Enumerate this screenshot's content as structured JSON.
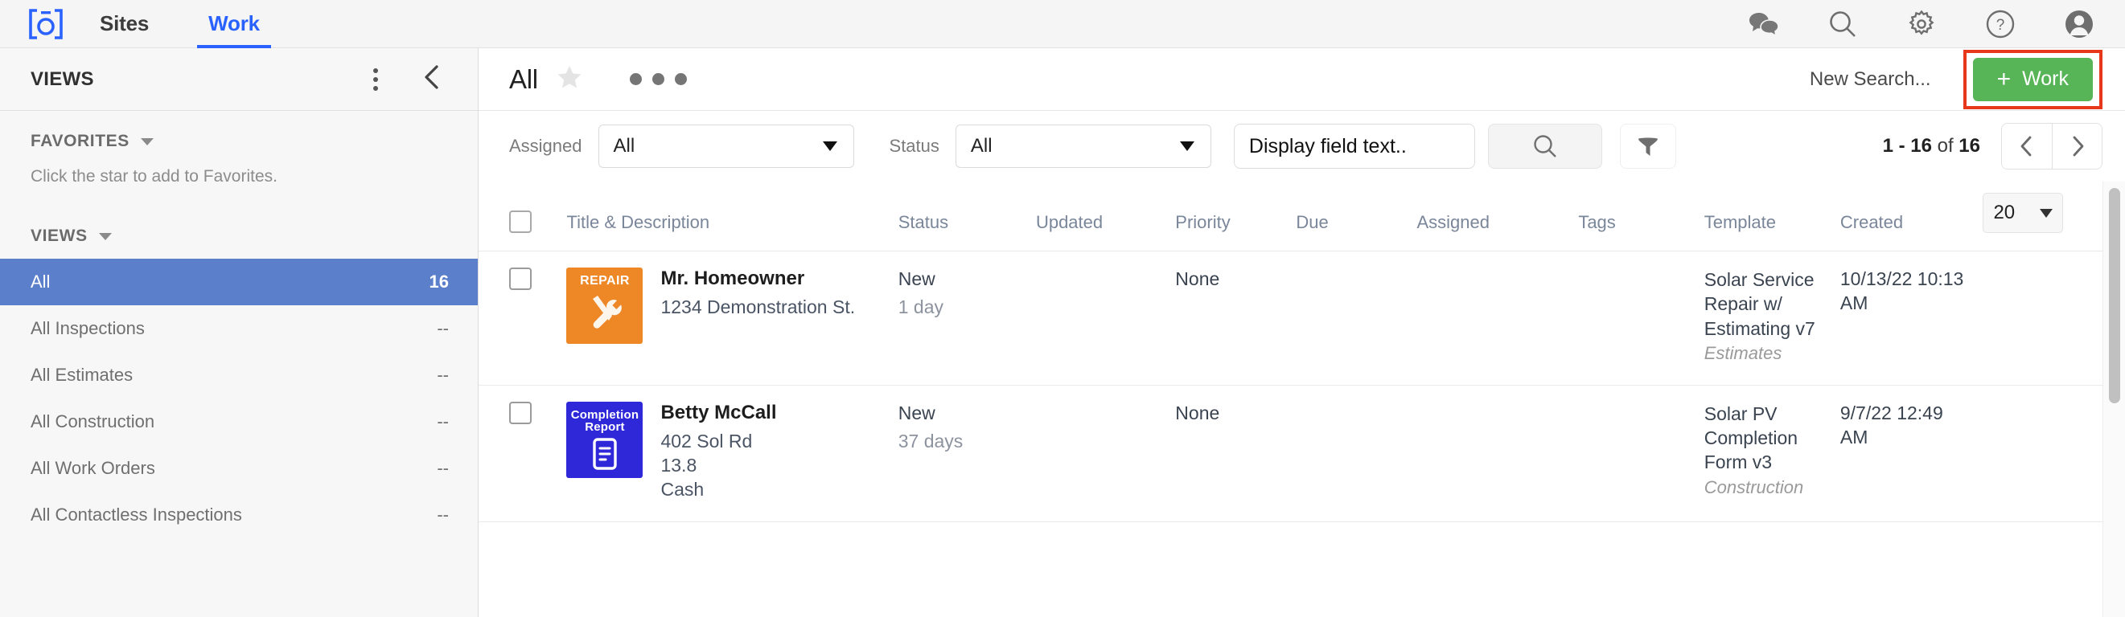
{
  "topnav": {
    "logo_name": "camera-logo",
    "tabs": [
      {
        "label": "Sites",
        "active": false
      },
      {
        "label": "Work",
        "active": true
      }
    ],
    "icons": [
      "chat-icon",
      "search-icon",
      "gear-icon",
      "help-icon",
      "avatar-icon"
    ]
  },
  "sidebar": {
    "title": "VIEWS",
    "favorites": {
      "label": "FAVORITES",
      "hint": "Click the star to add to Favorites."
    },
    "views_label": "VIEWS",
    "items": [
      {
        "label": "All",
        "count": "16",
        "active": true
      },
      {
        "label": "All Inspections",
        "count": "--",
        "active": false
      },
      {
        "label": "All Estimates",
        "count": "--",
        "active": false
      },
      {
        "label": "All Construction",
        "count": "--",
        "active": false
      },
      {
        "label": "All Work Orders",
        "count": "--",
        "active": false
      },
      {
        "label": "All Contactless Inspections",
        "count": "--",
        "active": false
      }
    ]
  },
  "main": {
    "page_title": "All",
    "new_search_label": "New Search...",
    "work_button_label": "Work",
    "work_button_plus": "+",
    "work_button_color": "#57b557",
    "highlight_color": "#e8381c"
  },
  "filters": {
    "assigned_label": "Assigned",
    "assigned_value": "All",
    "status_label": "Status",
    "status_value": "All",
    "display_field_value": "Display field text..",
    "display_field_placeholder": "Display field text..",
    "search_icon": "search-icon",
    "filter_icon": "funnel-icon",
    "pager_range": "1 - 16",
    "pager_of": "of",
    "pager_total": "16",
    "prev_icon": "chevron-left-icon",
    "next_icon": "chevron-right-icon"
  },
  "table": {
    "headers": [
      "Title & Description",
      "Status",
      "Updated",
      "Priority",
      "Due",
      "Assigned",
      "Tags",
      "Template",
      "Created"
    ],
    "page_size": "20",
    "rows": [
      {
        "badge_label": "REPAIR",
        "badge_type": "repair",
        "badge_icon": "tools-icon",
        "name": "Mr. Homeowner",
        "sub_lines": [
          "1234 Demonstration St."
        ],
        "status": "New",
        "updated": "1 day",
        "priority": "None",
        "due": "",
        "assigned": "",
        "tags": "",
        "template": "Solar Service Repair w/ Estimating v7",
        "template_sub": "Estimates",
        "created": "10/13/22 10:13 AM"
      },
      {
        "badge_label": "Completion Report",
        "badge_type": "completion",
        "badge_icon": "document-icon",
        "name": "Betty McCall",
        "sub_lines": [
          "402 Sol Rd",
          "13.8",
          "Cash"
        ],
        "status": "New",
        "updated": "37 days",
        "priority": "None",
        "due": "",
        "assigned": "",
        "tags": "",
        "template": "Solar PV Completion Form v3",
        "template_sub": "Construction",
        "created": "9/7/22 12:49 AM"
      }
    ]
  }
}
